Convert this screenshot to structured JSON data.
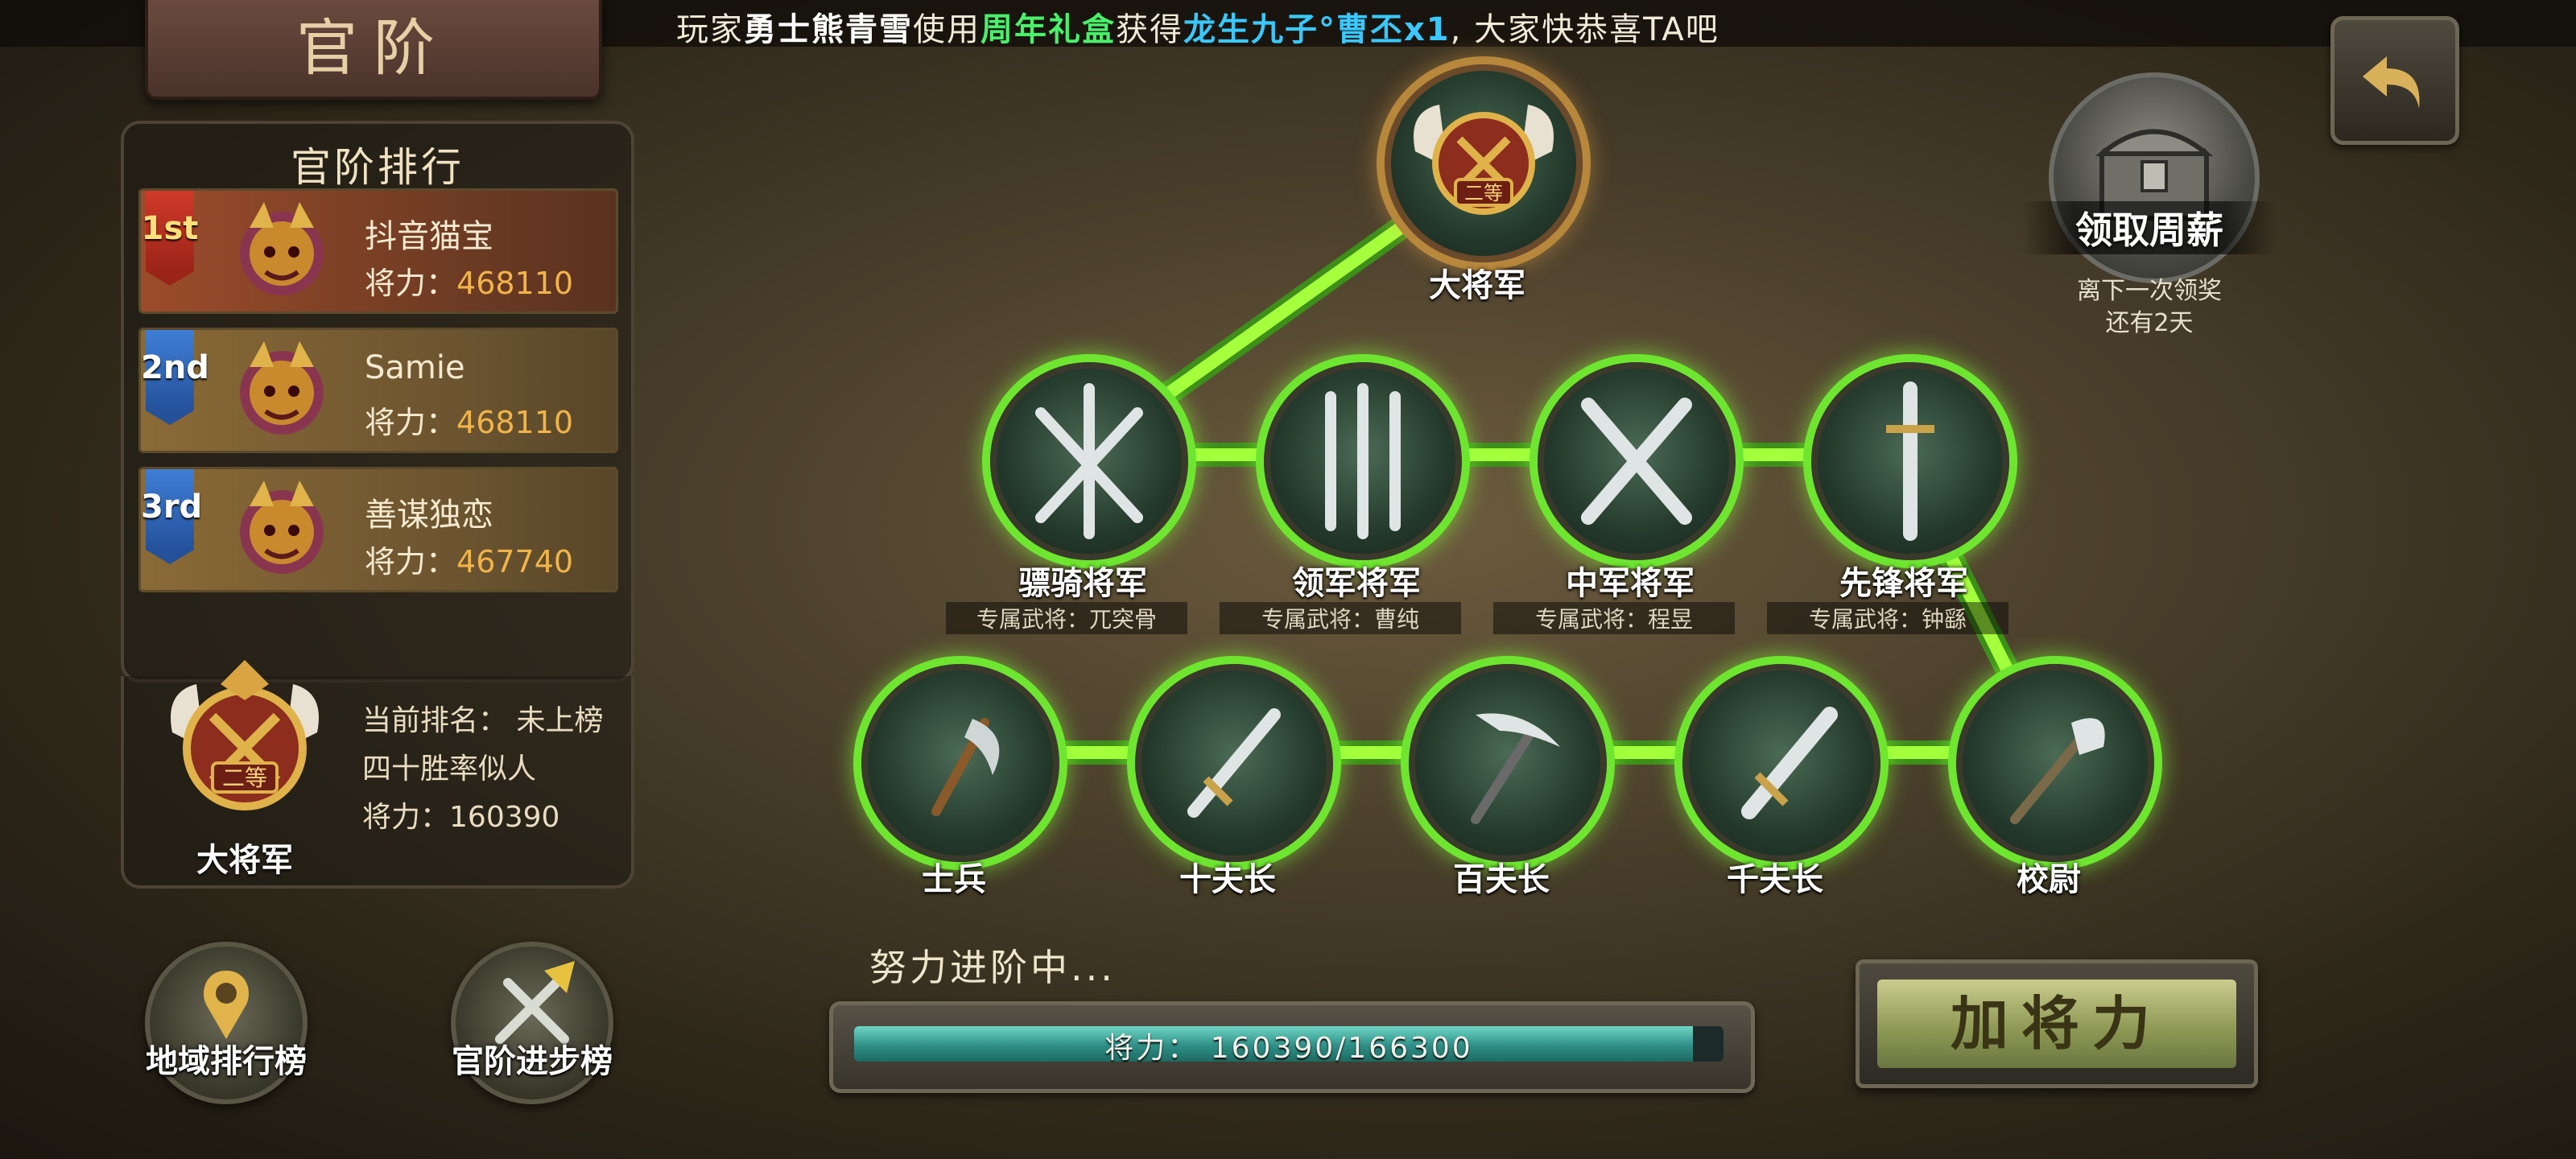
{
  "marquee": {
    "prefix": "玩家",
    "player": "勇士熊青雪",
    "verb": "使用",
    "item": "周年礼盒",
    "gain": "获得",
    "reward": "龙生九子°曹丕x1",
    "suffix": ", 大家快恭喜TA吧"
  },
  "title": "官阶",
  "ranking": {
    "title": "官阶排行",
    "power_label": "将力：",
    "entries": [
      {
        "rank": "1st",
        "name": "抖音猫宝",
        "power": "468110"
      },
      {
        "rank": "2nd",
        "name": "Samie",
        "power": "468110"
      },
      {
        "rank": "3rd",
        "name": "善谋独恋",
        "power": "467740"
      }
    ]
  },
  "me": {
    "current_rank_label": "当前排名：",
    "current_rank_value": "未上榜",
    "name": "四十胜率似人",
    "power_label": "将力：",
    "power": "160390",
    "rank_title": "大将军",
    "rank_badge": "二等"
  },
  "buttons": {
    "region_rank": "地域排行榜",
    "advance_rank": "官阶进步榜",
    "add_power": "加将力"
  },
  "salary": {
    "label": "领取周薪",
    "note_line1": "离下一次领奖",
    "note_line2": "还有2天"
  },
  "tree": {
    "top": {
      "label": "大将军",
      "badge": "二等"
    },
    "generals": [
      {
        "label": "骠骑将军",
        "exclusive": "专属武将：兀突骨"
      },
      {
        "label": "领军将军",
        "exclusive": "专属武将：曹纯"
      },
      {
        "label": "中军将军",
        "exclusive": "专属武将：程昱"
      },
      {
        "label": "先锋将军",
        "exclusive": "专属武将：钟繇"
      }
    ],
    "base": [
      {
        "label": "士兵"
      },
      {
        "label": "十夫长"
      },
      {
        "label": "百夫长"
      },
      {
        "label": "千夫长"
      },
      {
        "label": "校尉"
      }
    ]
  },
  "progress": {
    "title": "努力进阶中...",
    "text": "将力：  160390/166300",
    "current": 160390,
    "target": 166300
  },
  "colors": {
    "path_glow": "#6ee630",
    "gold": "#f0b44a",
    "marquee_item": "#49f06b",
    "marquee_reward": "#39c8ff"
  }
}
